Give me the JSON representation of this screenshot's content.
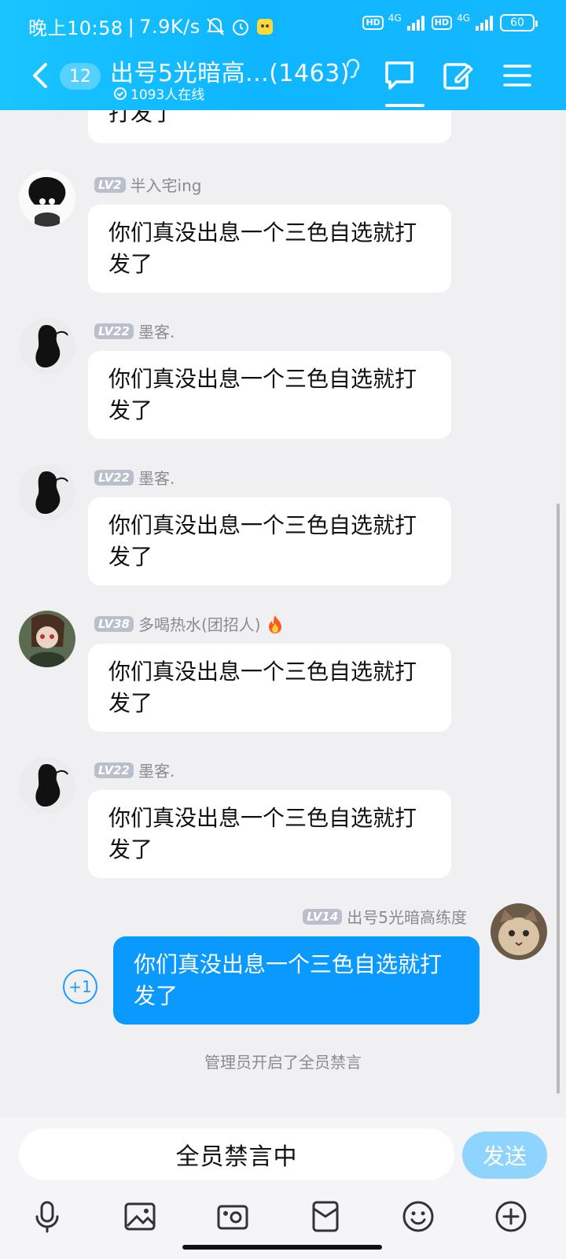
{
  "status_bar": {
    "time": "晚上10:58",
    "speed": "7.9K/s",
    "hd1": "HD",
    "net1": "4G",
    "hd2": "HD",
    "net2": "4G",
    "battery": "60"
  },
  "header": {
    "unread_count": "12",
    "title": "出号5光暗高...(1463)",
    "online": "1093人在线"
  },
  "messages": [
    {
      "level": "LV2",
      "name": "半入宅ing",
      "text": "你们真没出息一个三色自选就打发了"
    },
    {
      "level": "LV22",
      "name": "墨客.",
      "text": "你们真没出息一个三色自选就打发了"
    },
    {
      "level": "LV22",
      "name": "墨客.",
      "text": "你们真没出息一个三色自选就打发了"
    },
    {
      "level": "LV38",
      "name": "多喝热水(团招人)",
      "text": "你们真没出息一个三色自选就打发了"
    },
    {
      "level": "LV22",
      "name": "墨客.",
      "text": "你们真没出息一个三色自选就打发了"
    }
  ],
  "partial_message": {
    "text": "打发了"
  },
  "my_message": {
    "level": "LV14",
    "name": "出号5光暗高练度",
    "text": "你们真没出息一个三色自选就打发了",
    "plus_one": "+1"
  },
  "system_message": "管理员开启了全员禁言",
  "input": {
    "status": "全员禁言中",
    "send_label": "发送"
  },
  "toolbar": {
    "icons": [
      "microphone-icon",
      "image-icon",
      "camera-icon",
      "red-packet-icon",
      "emoji-icon",
      "plus-icon"
    ]
  },
  "colors": {
    "header": "#14b8ff",
    "my_bubble": "#0a99ff",
    "send_disabled": "#8fd3ff",
    "level_badge": "#b9c0cc"
  }
}
